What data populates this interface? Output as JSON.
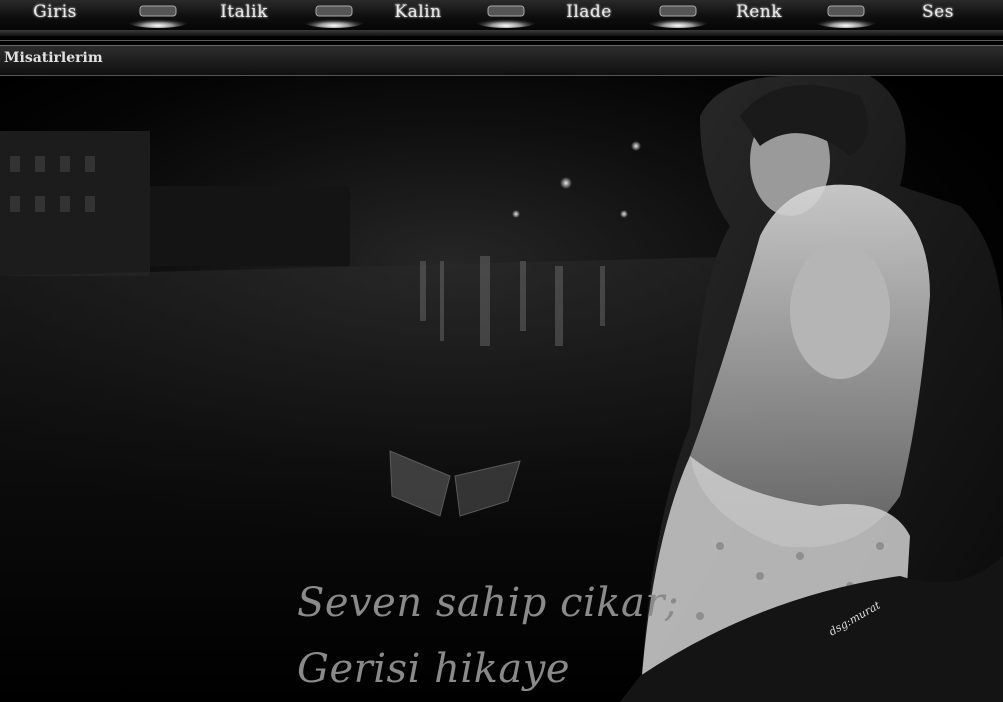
{
  "nav": {
    "items": [
      {
        "label": "Giris"
      },
      {
        "label": "Italik"
      },
      {
        "label": "Kalin"
      },
      {
        "label": "Ilade"
      },
      {
        "label": "Renk"
      },
      {
        "label": "Ses"
      }
    ]
  },
  "subbar": {
    "title": "Misatirlerim"
  },
  "scene": {
    "quote_line1": "Seven sahip cikar;",
    "quote_line2": "Gerisi hikaye",
    "signature": "dsg:murat"
  }
}
